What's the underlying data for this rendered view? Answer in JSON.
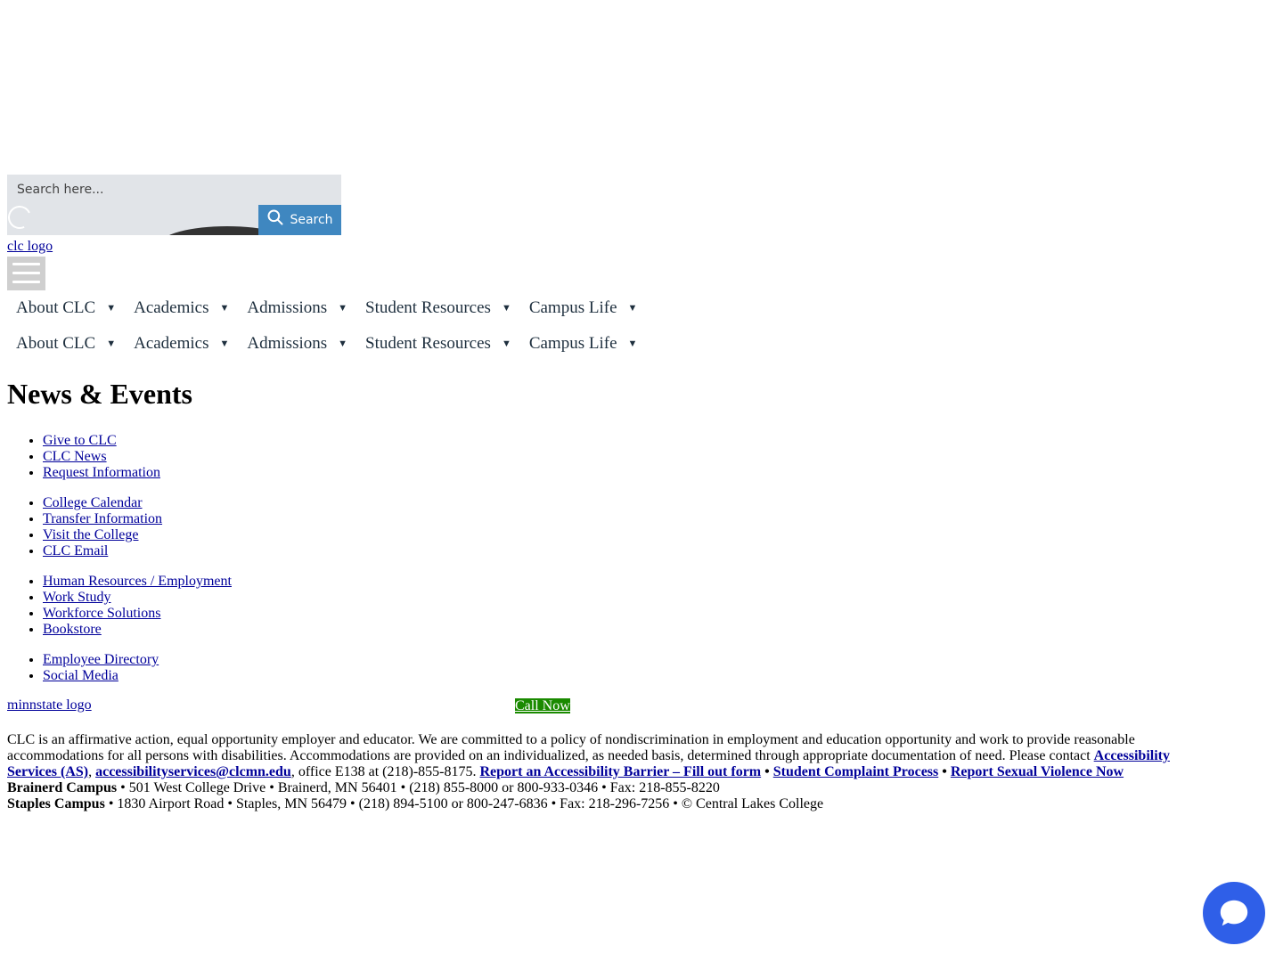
{
  "search": {
    "placeholder": "Search here...",
    "button_label": "Search"
  },
  "header": {
    "logo_alt": "clc logo"
  },
  "nav": [
    {
      "label": "About CLC"
    },
    {
      "label": "Academics"
    },
    {
      "label": "Admissions"
    },
    {
      "label": "Student Resources"
    },
    {
      "label": "Campus Life"
    }
  ],
  "main": {
    "title": "News & Events",
    "link_groups": [
      [
        "Give to CLC",
        "CLC News",
        "Request Information"
      ],
      [
        "College Calendar",
        "Transfer Information",
        "Visit the College",
        "CLC Email"
      ],
      [
        "Human Resources / Employment",
        "Work Study",
        "Workforce Solutions",
        "Bookstore"
      ],
      [
        "Employee Directory",
        "Social Media"
      ]
    ]
  },
  "footer": {
    "minnstate_alt": "minnstate logo",
    "call_now": "Call Now",
    "statement_1": "CLC is an affirmative action, equal opportunity employer and educator.  We are committed to a policy of nondiscrimination in employment and education opportunity and work to provide reasonable accommodations for all persons with disabilities.  Accommodations are provided on an individualized, as needed basis, determined through appropriate documentation of need.  Please contact ",
    "as_link": "Accessibility Services (AS)",
    "sep_comma": ", ",
    "email_link": "accessibilityservices@clcmn.edu",
    "statement_2": ", office E138 at (218)-855-8175.  ",
    "barrier_link": "Report an Accessibility Barrier – Fill out form",
    "bullet": " • ",
    "complaint_link": "Student Complaint Process",
    "violence_link": "Report Sexual Violence Now",
    "brainerd_label": "Brainerd Campus",
    "brainerd_info": " • 501 West College Drive • Brainerd, MN 56401 • (218) 855-8000 or 800-933-0346 • Fax: 218-855-8220",
    "staples_label": "Staples Campus",
    "staples_info": " • 1830 Airport Road • Staples, MN 56479 • (218) 894-5100 or 800-247-6836 • Fax: 218-296-7256 • © Central Lakes College"
  },
  "colors": {
    "search_button": "#3f87c0",
    "call_now_bg": "#1a8a00",
    "chat_bubble": "#2f5fe8",
    "link": "#00009a"
  },
  "icons": {
    "search": "search-icon",
    "chat": "chat-bubble-icon",
    "menu": "hamburger-menu-icon",
    "nav_caret": "caret-down-icon"
  }
}
